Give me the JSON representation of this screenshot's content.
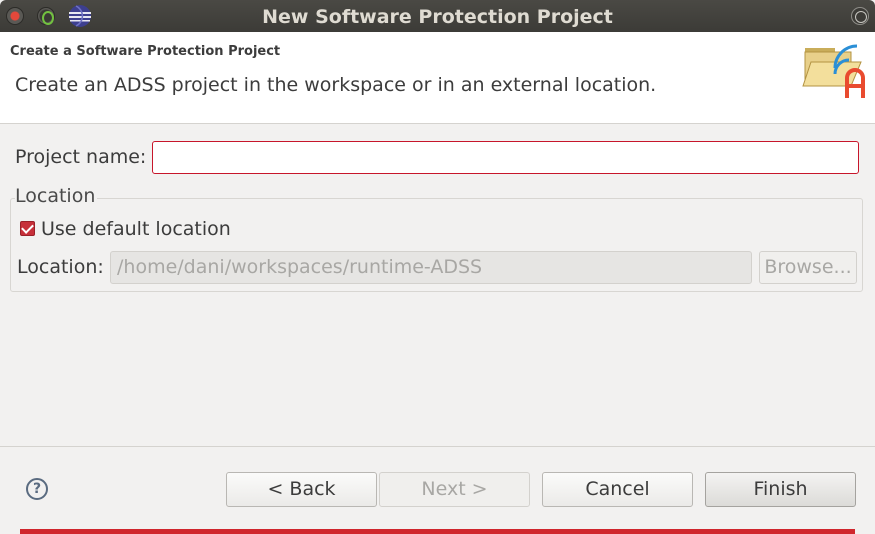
{
  "window": {
    "title": "New Software Protection Project"
  },
  "header": {
    "title": "Create a Software Protection Project",
    "description": "Create an ADSS project in the workspace or in an external location."
  },
  "form": {
    "project_name_label": "Project name:",
    "project_name_value": "",
    "location_group_label": "Location",
    "use_default_label": "Use default location",
    "use_default_checked": true,
    "location_label": "Location:",
    "location_value": "/home/dani/workspaces/runtime-ADSS",
    "browse_label": "Browse..."
  },
  "footer": {
    "help_glyph": "?",
    "back_label": "< Back",
    "next_label": "Next >",
    "cancel_label": "Cancel",
    "finish_label": "Finish"
  },
  "icons": {
    "close": "close-icon",
    "minimize": "minimize-icon",
    "app": "eclipse-globe-icon",
    "maximize": "maximize-icon",
    "wizard": "folder-wizard-icon",
    "help": "help-icon"
  },
  "colors": {
    "accent": "#c7162b",
    "titlebar": "#3c3b37",
    "checkbox": "#c7303a"
  }
}
